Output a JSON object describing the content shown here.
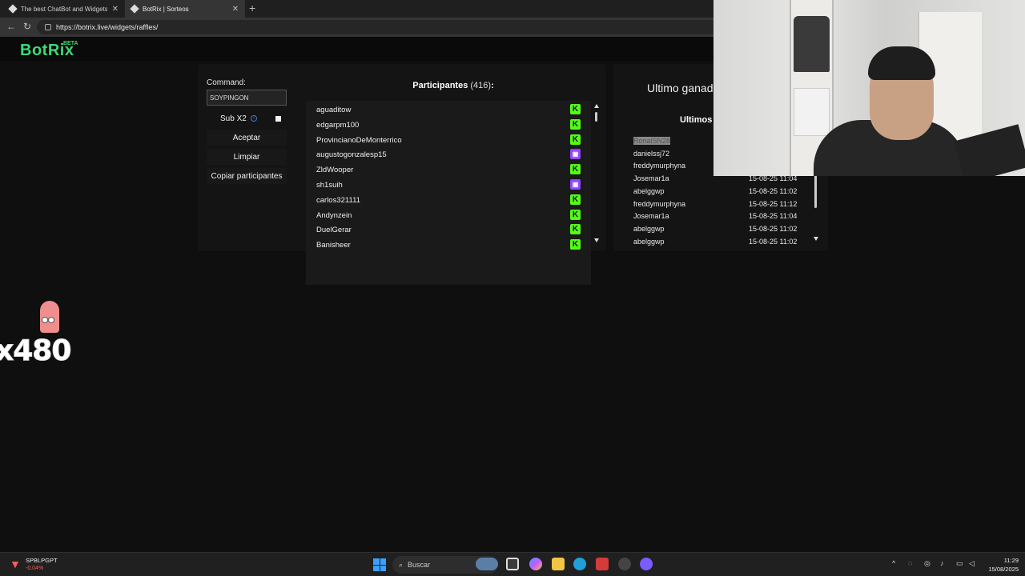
{
  "browser": {
    "tabs": [
      {
        "title": "The best ChatBot and Widgets fo",
        "active": false
      },
      {
        "title": "BotRix | Sorteos",
        "active": true
      }
    ],
    "new_tab": "+",
    "url": "https://botrix.live/widgets/raffles/"
  },
  "site": {
    "logo": "BotRix",
    "beta": "BETA"
  },
  "raffle": {
    "command_label": "Command:",
    "command_value": "SOYPINGON",
    "sub_label": "Sub X2",
    "sub_info": "i",
    "accept": "Aceptar",
    "clear": "Limpiar",
    "copy": "Copiar participantes",
    "participants_title": "Participantes",
    "participants_count": "(416)",
    "participants_colon": ":",
    "participants": [
      {
        "name": "aguaditow",
        "platform": "kick"
      },
      {
        "name": "edgarpm100",
        "platform": "kick"
      },
      {
        "name": "ProvincianoDeMonterrico",
        "platform": "kick"
      },
      {
        "name": "augustogonzalesp15",
        "platform": "twitch"
      },
      {
        "name": "ZldWooper",
        "platform": "kick"
      },
      {
        "name": "sh1suih",
        "platform": "twitch"
      },
      {
        "name": "carlos321111",
        "platform": "kick"
      },
      {
        "name": "Andynzein",
        "platform": "kick"
      },
      {
        "name": "DuelGerar",
        "platform": "kick"
      },
      {
        "name": "Banisheer",
        "platform": "kick"
      }
    ],
    "last_winner_title": "Ultimo ganad",
    "last_winners_title": "Ultimos",
    "winners": [
      {
        "name": "RonalSN28",
        "date": ""
      },
      {
        "name": "danielssj72",
        "date": ""
      },
      {
        "name": "freddymurphyna",
        "date": ""
      },
      {
        "name": "Josemar1a",
        "date": "15-08-25 11:04"
      },
      {
        "name": "abelggwp",
        "date": "15-08-25 11:02"
      },
      {
        "name": "freddymurphyna",
        "date": "15-08-25 11:12"
      },
      {
        "name": "Josemar1a",
        "date": "15-08-25 11:04"
      },
      {
        "name": "abelggwp",
        "date": "15-08-25 11:02"
      },
      {
        "name": "abelggwp",
        "date": "15-08-25 11:02"
      }
    ]
  },
  "overlay": {
    "sticker_text": "x480"
  },
  "taskbar": {
    "stock_name": "SPBLPGPT",
    "stock_change": "-0.04%",
    "search_placeholder": "Buscar",
    "time": "11:29",
    "date": "15/08/2025"
  },
  "colors": {
    "brand": "#3dd87a",
    "kick": "#53fc18",
    "twitch": "#9146ff"
  }
}
